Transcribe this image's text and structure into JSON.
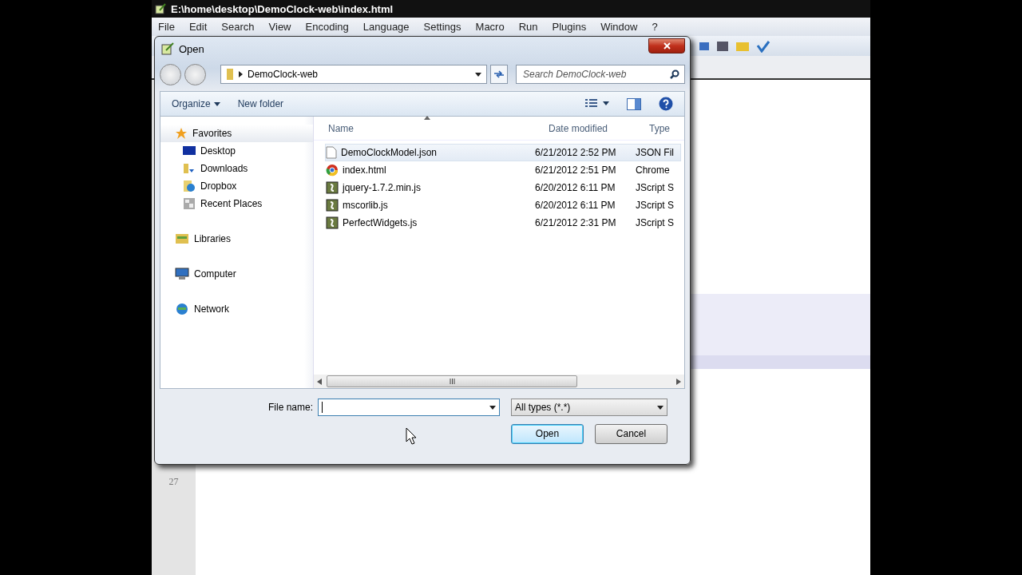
{
  "editor": {
    "title": "E:\\home\\desktop\\DemoClock-web\\index.html",
    "menu": [
      "File",
      "Edit",
      "Search",
      "View",
      "Encoding",
      "Language",
      "Settings",
      "Macro",
      "Run",
      "Plugins",
      "Window",
      "?"
    ],
    "line_numbers": [
      "27"
    ]
  },
  "dialog": {
    "title": "Open",
    "address": {
      "path": "DemoClock-web"
    },
    "search": {
      "placeholder": "Search DemoClock-web"
    },
    "commands": [
      {
        "label": "Organize",
        "kind": "menu"
      },
      {
        "label": "New folder",
        "kind": "button"
      }
    ],
    "nav": [
      {
        "label": "Favorites",
        "selected": true,
        "children": [
          {
            "label": "Desktop",
            "selected": false
          },
          {
            "label": "Downloads",
            "selected": false
          },
          {
            "label": "Dropbox",
            "selected": false
          },
          {
            "label": "Recent Places",
            "selected": false
          }
        ]
      },
      {
        "label": "Libraries",
        "selected": false
      },
      {
        "label": "Computer",
        "selected": false
      },
      {
        "label": "Network",
        "selected": false
      }
    ],
    "columns": [
      {
        "label": "Name",
        "sorted": true
      },
      {
        "label": "Date modified",
        "sorted": false
      },
      {
        "label": "Type",
        "sorted": false
      }
    ],
    "rows": [
      {
        "name": "DemoClockModel.json",
        "date": "6/21/2012 2:52 PM",
        "type": "JSON Fil",
        "selected": true
      },
      {
        "name": "index.html",
        "date": "6/21/2012 2:51 PM",
        "type": "Chrome",
        "selected": false
      },
      {
        "name": "jquery-1.7.2.min.js",
        "date": "6/20/2012 6:11 PM",
        "type": "JScript S",
        "selected": false
      },
      {
        "name": "mscorlib.js",
        "date": "6/20/2012 6:11 PM",
        "type": "JScript S",
        "selected": false
      },
      {
        "name": "PerfectWidgets.js",
        "date": "6/21/2012 2:31 PM",
        "type": "JScript S",
        "selected": false
      }
    ],
    "file_name": {
      "label": "File name:",
      "focused": true
    },
    "filter": {
      "value": "All types (*.*)"
    },
    "buttons": [
      {
        "label": "Open",
        "default": true
      },
      {
        "label": "Cancel",
        "default": false
      }
    ]
  }
}
